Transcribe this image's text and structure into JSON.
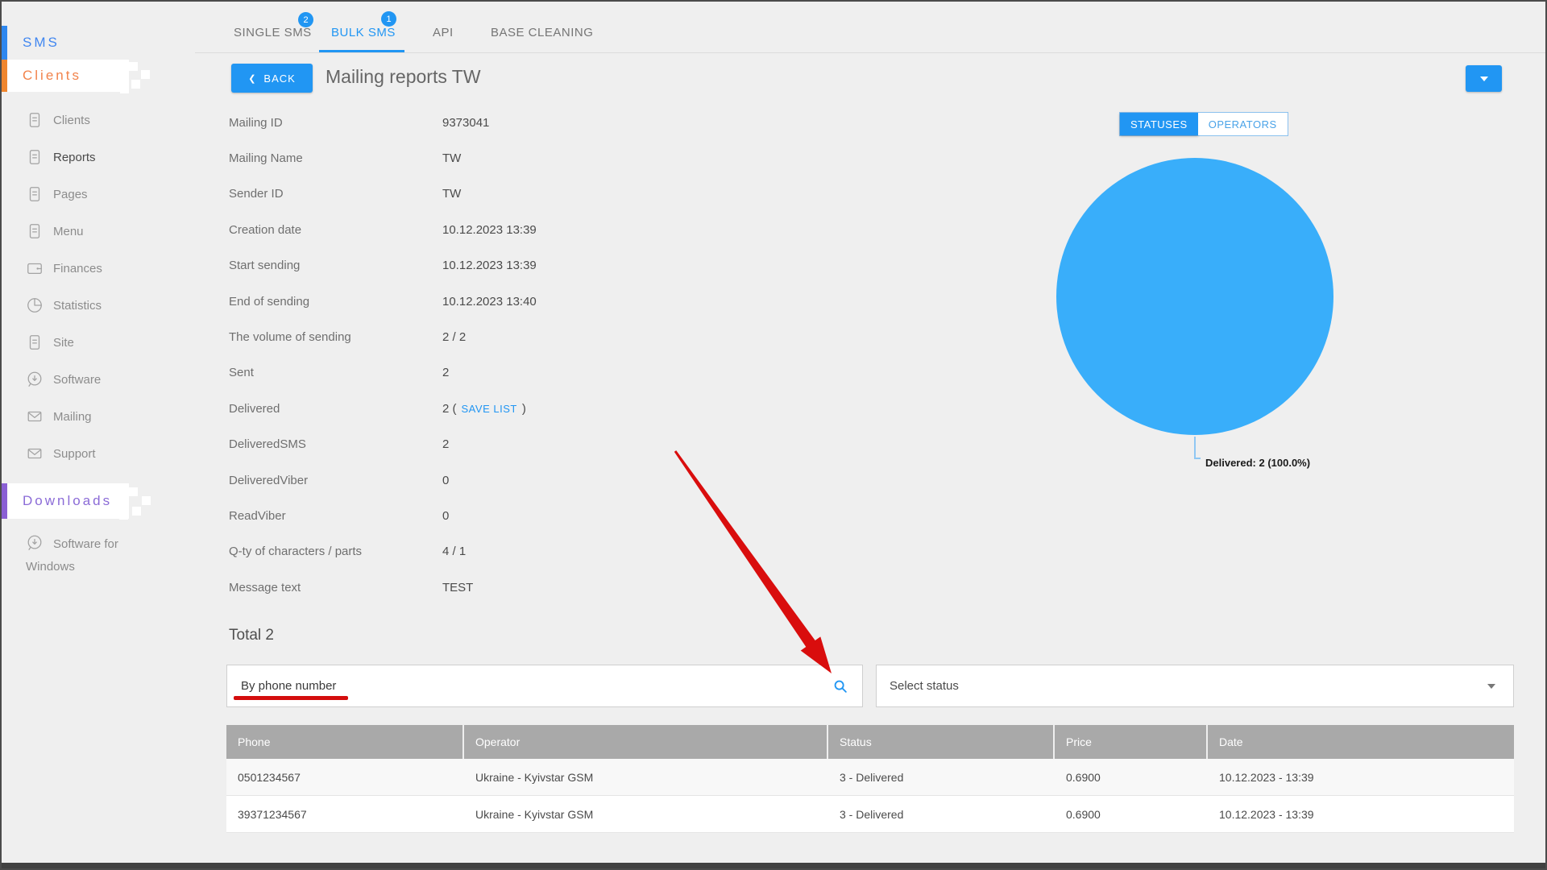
{
  "sidebar": {
    "sms_label": "SMS",
    "clients_label": "Clients",
    "downloads_label": "Downloads",
    "items": [
      {
        "label": "Clients",
        "icon": "document-icon",
        "active": false
      },
      {
        "label": "Reports",
        "icon": "document-icon",
        "active": true
      },
      {
        "label": "Pages",
        "icon": "document-icon",
        "active": false
      },
      {
        "label": "Menu",
        "icon": "document-icon",
        "active": false
      },
      {
        "label": "Finances",
        "icon": "wallet-icon",
        "active": false
      },
      {
        "label": "Statistics",
        "icon": "pie-icon",
        "active": false
      },
      {
        "label": "Site",
        "icon": "document-icon",
        "active": false
      },
      {
        "label": "Software",
        "icon": "download-icon",
        "active": false
      },
      {
        "label": "Mailing",
        "icon": "envelope-icon",
        "active": false
      },
      {
        "label": "Support",
        "icon": "envelope-icon",
        "active": false
      }
    ],
    "downloads_items": [
      {
        "label": "Software for Windows",
        "icon": "download-icon"
      }
    ]
  },
  "tabs": [
    {
      "label": "SINGLE SMS",
      "badge": "2",
      "active": false
    },
    {
      "label": "BULK SMS",
      "badge": "1",
      "active": true
    },
    {
      "label": "API",
      "badge": null,
      "active": false
    },
    {
      "label": "BASE CLEANING",
      "badge": null,
      "active": false
    }
  ],
  "header": {
    "back_label": "BACK",
    "title": "Mailing reports TW"
  },
  "details": [
    {
      "label": "Mailing ID",
      "value": "9373041"
    },
    {
      "label": "Mailing Name",
      "value": "TW"
    },
    {
      "label": "Sender ID",
      "value": "TW"
    },
    {
      "label": "Creation date",
      "value": "10.12.2023 13:39"
    },
    {
      "label": "Start sending",
      "value": "10.12.2023 13:39"
    },
    {
      "label": "End of sending",
      "value": "10.12.2023 13:40"
    },
    {
      "label": "The volume of sending",
      "value": "2 / 2"
    },
    {
      "label": "Sent",
      "value": "2"
    },
    {
      "label": "Delivered",
      "value": "2 (",
      "link": "SAVE LIST",
      "value_suffix": ")"
    },
    {
      "label": "DeliveredSMS",
      "value": "2"
    },
    {
      "label": "DeliveredViber",
      "value": "0"
    },
    {
      "label": "ReadViber",
      "value": "0"
    },
    {
      "label": "Q-ty of characters / parts",
      "value": "4 / 1"
    },
    {
      "label": "Message text",
      "value": "TEST"
    }
  ],
  "chart": {
    "toggle": [
      {
        "label": "STATUSES",
        "active": true
      },
      {
        "label": "OPERATORS",
        "active": false
      }
    ],
    "callout": "Delivered: 2 (100.0%)"
  },
  "chart_data": {
    "type": "pie",
    "labels": [
      "Delivered"
    ],
    "values": [
      2
    ],
    "percents": [
      100.0
    ],
    "colors": [
      "#39aefa"
    ],
    "annotation": "Delivered: 2 (100.0%)",
    "legend_position": "below-callout"
  },
  "results": {
    "total_label": "Total 2",
    "search_value": "By phone number",
    "status_placeholder": "Select status"
  },
  "table": {
    "columns": [
      "Phone",
      "Operator",
      "Status",
      "Price",
      "Date"
    ],
    "rows": [
      [
        "0501234567",
        "Ukraine - Kyivstar GSM",
        "3 - Delivered",
        "0.6900",
        "10.12.2023 - 13:39"
      ],
      [
        "39371234567",
        "Ukraine - Kyivstar GSM",
        "3 - Delivered",
        "0.6900",
        "10.12.2023 - 13:39"
      ]
    ]
  },
  "colors": {
    "accent": "#2196f3",
    "pie": "#39aefa",
    "sms_blue": "#4187f0",
    "clients_orange": "#f2834b",
    "downloads_purple": "#8b6bd7",
    "annotation_red": "#d40d0d",
    "table_header_bg": "#a9a9a9"
  }
}
